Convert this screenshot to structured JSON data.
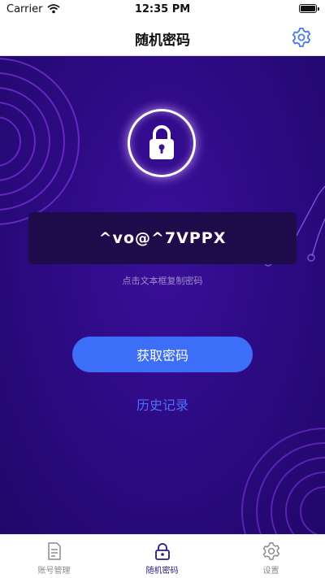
{
  "status_bar": {
    "carrier": "Carrier",
    "time": "12:35 PM"
  },
  "nav": {
    "title": "随机密码",
    "settings_icon": "gear-icon"
  },
  "main": {
    "password": "^vo@^7VPPX",
    "hint": "点击文本框复制密码",
    "get_button_label": "获取密码",
    "history_link_label": "历史记录",
    "lock_icon": "lock-icon"
  },
  "tab_bar": {
    "tabs": [
      {
        "label": "账号管理",
        "icon": "document-icon",
        "active": false
      },
      {
        "label": "随机密码",
        "icon": "lock-icon",
        "active": true
      },
      {
        "label": "设置",
        "icon": "gear-icon",
        "active": false
      }
    ]
  },
  "colors": {
    "background_purple": "#2b0a80",
    "accent_blue": "#3d6ef7",
    "link_blue": "#4e6dff",
    "active_tab": "#2a1a7a"
  }
}
